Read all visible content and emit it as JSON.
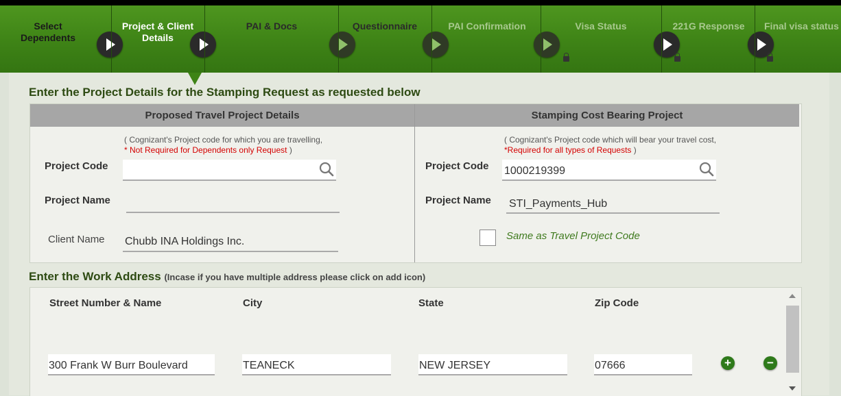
{
  "wizard": {
    "steps": [
      {
        "label": "Select\nDependents",
        "state": "done"
      },
      {
        "label": "Project & Client\nDetails",
        "state": "active"
      },
      {
        "label": "PAI & Docs",
        "state": "future"
      },
      {
        "label": "Questionnaire",
        "state": "future"
      },
      {
        "label": "PAI Confirmation",
        "state": "locked"
      },
      {
        "label": "Visa Status",
        "state": "locked"
      },
      {
        "label": "221G Response",
        "state": "locked"
      },
      {
        "label": "Final visa status",
        "state": "locked"
      }
    ]
  },
  "project_section": {
    "title": "Enter the Project Details for the Stamping Request as requested below",
    "travel": {
      "header": "Proposed Travel Project Details",
      "note_line1": "( Cognizant's Project code for which you are travelling,",
      "note_required": "* Not Required for Dependents only Request",
      "note_close": " )",
      "project_code_label": "Project Code",
      "project_code_value": "",
      "project_name_label": "Project Name",
      "project_name_value": "",
      "client_name_label": "Client Name",
      "client_name_value": "Chubb INA Holdings Inc."
    },
    "cost": {
      "header": "Stamping Cost Bearing Project",
      "note_line1": "( Cognizant's Project code which will bear your travel cost,",
      "note_required": "*Required for all types of Requests",
      "note_close": " )",
      "project_code_label": "Project Code",
      "project_code_value": "1000219399",
      "project_name_label": "Project Name",
      "project_name_value": "STI_Payments_Hub",
      "same_as_label": "Same as Travel Project Code",
      "same_as_checked": false
    }
  },
  "address_section": {
    "title": "Enter the Work Address",
    "hint": "(Incase if you have multiple address please click on add icon)",
    "headers": {
      "street": "Street Number & Name",
      "city": "City",
      "state": "State",
      "zip": "Zip Code"
    },
    "rows": [
      {
        "street": "300 Frank W Burr Boulevard",
        "city": "TEANECK",
        "state": "NEW JERSEY",
        "zip": "07666"
      }
    ],
    "add_symbol": "+",
    "remove_symbol": "−"
  },
  "colors": {
    "wizard_green": "#3e8316",
    "required_red": "#d40000",
    "title_green": "#2d4a12",
    "button_green": "#2e7a1a"
  }
}
